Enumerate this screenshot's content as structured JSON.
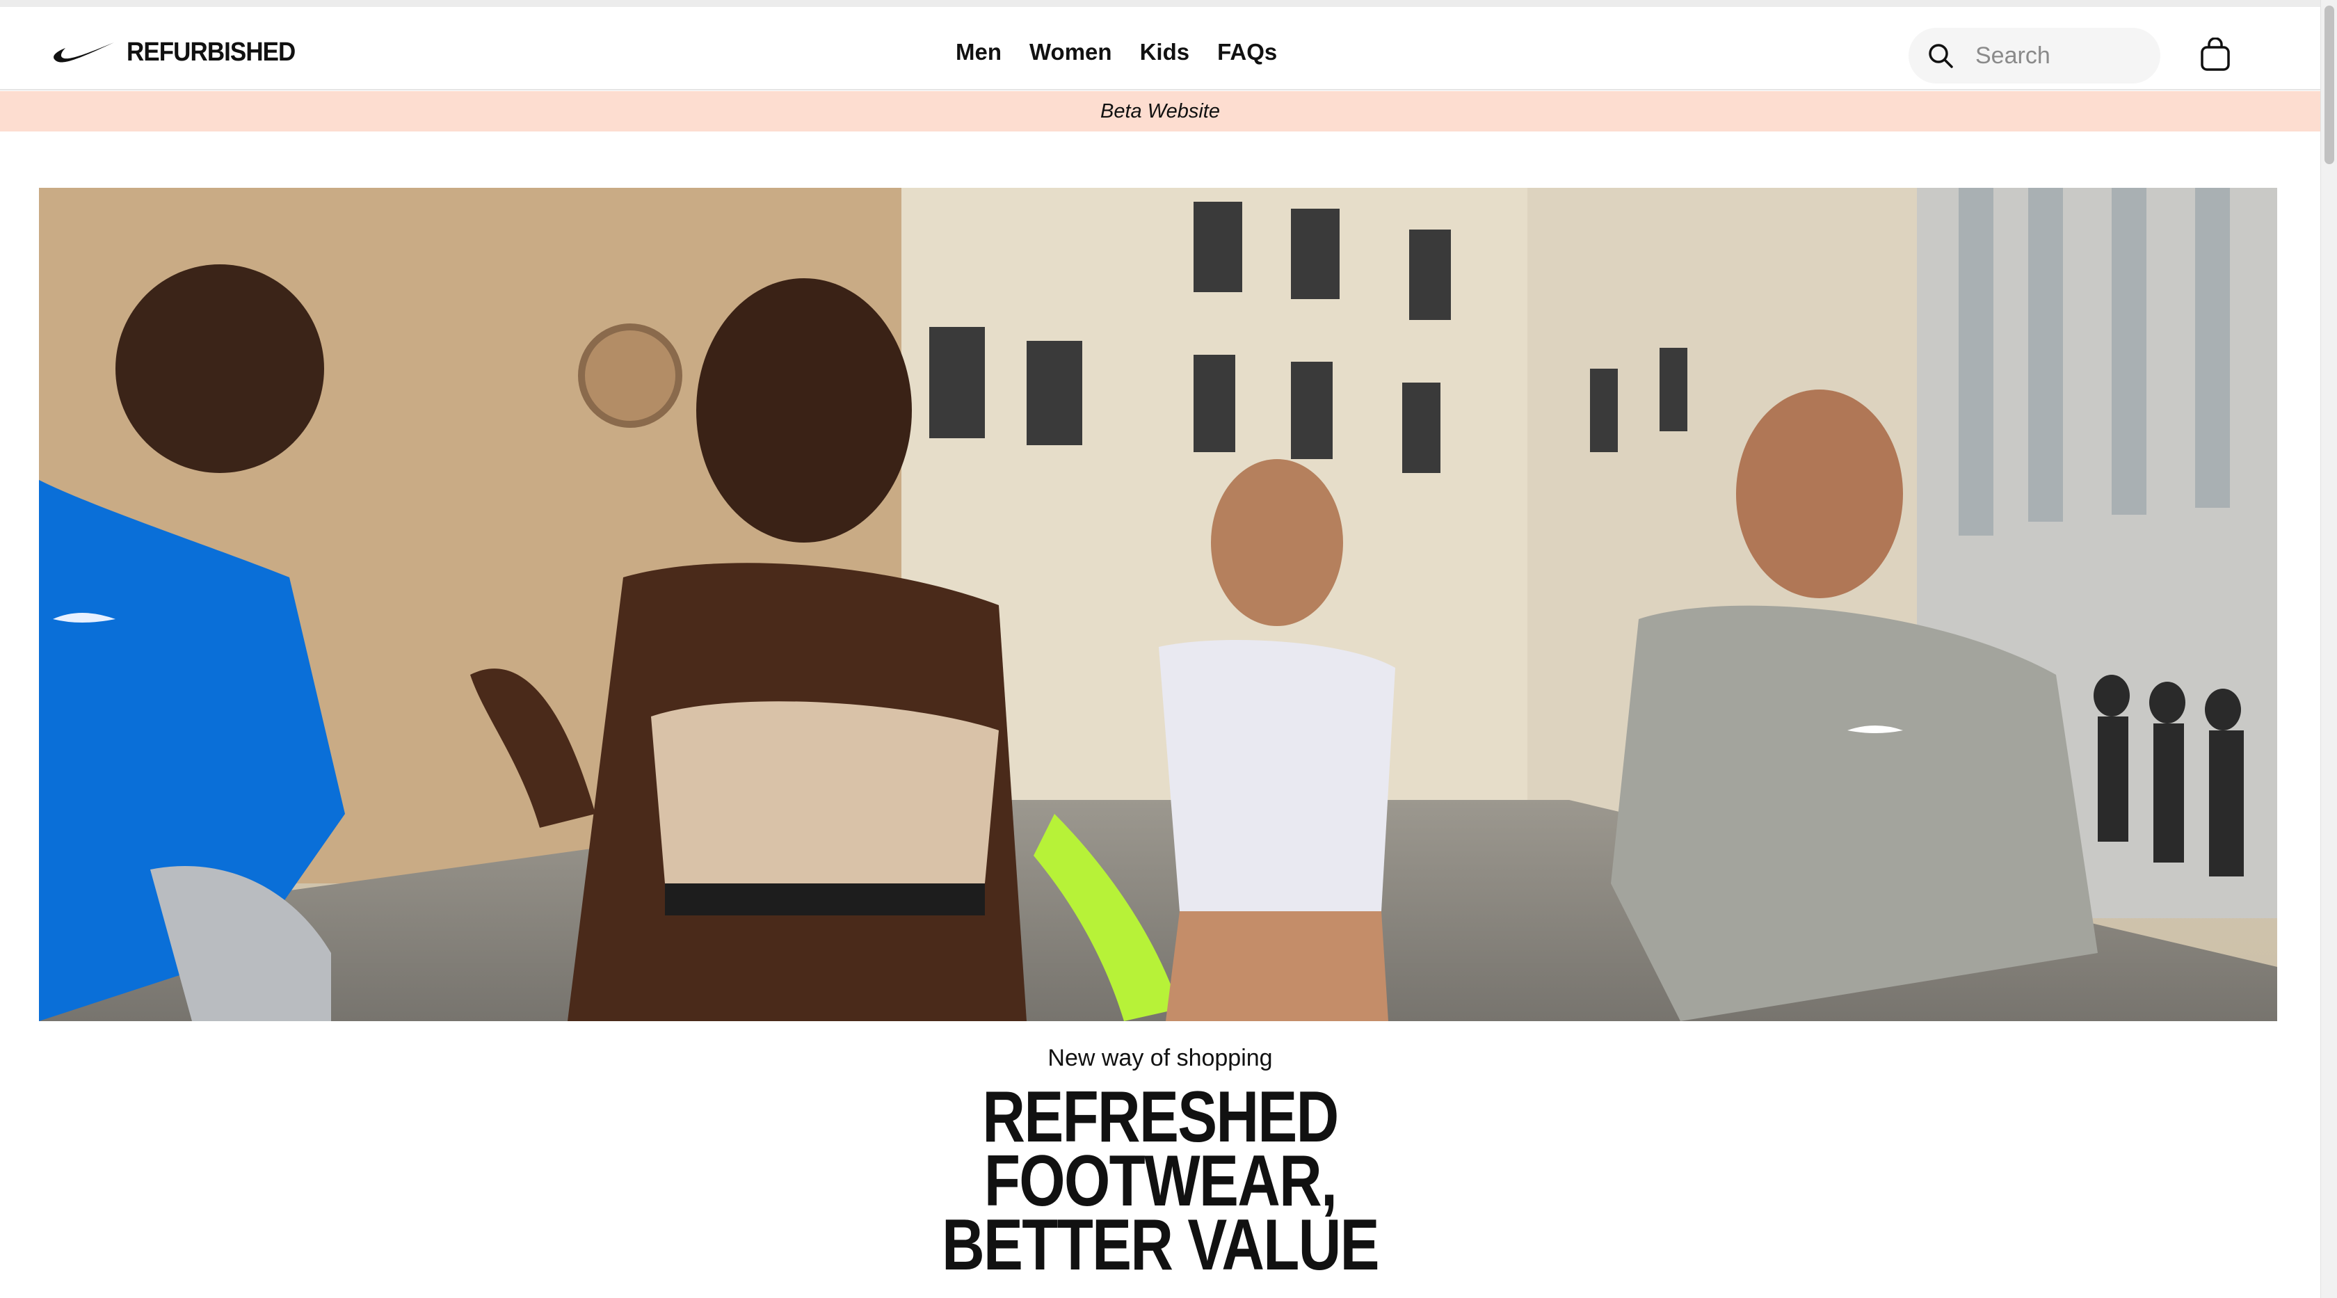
{
  "header": {
    "logo_text": "REFURBISHED",
    "logo_icon": "swoosh-icon",
    "nav": [
      {
        "label": "Men"
      },
      {
        "label": "Women"
      },
      {
        "label": "Kids"
      },
      {
        "label": "FAQs"
      }
    ],
    "search": {
      "placeholder": "Search",
      "icon": "search-icon"
    },
    "bag_icon": "shopping-bag-icon"
  },
  "banner": {
    "text": "Beta Website",
    "color": "#fdddd0"
  },
  "hero": {
    "eyebrow": "New way of shopping",
    "headline_lines": [
      "REFRESHED",
      "FOOTWEAR,",
      "BETTER VALUE"
    ]
  },
  "colors": {
    "text": "#111111",
    "search_bg": "#f5f5f5",
    "banner_bg": "#fdddd0"
  }
}
